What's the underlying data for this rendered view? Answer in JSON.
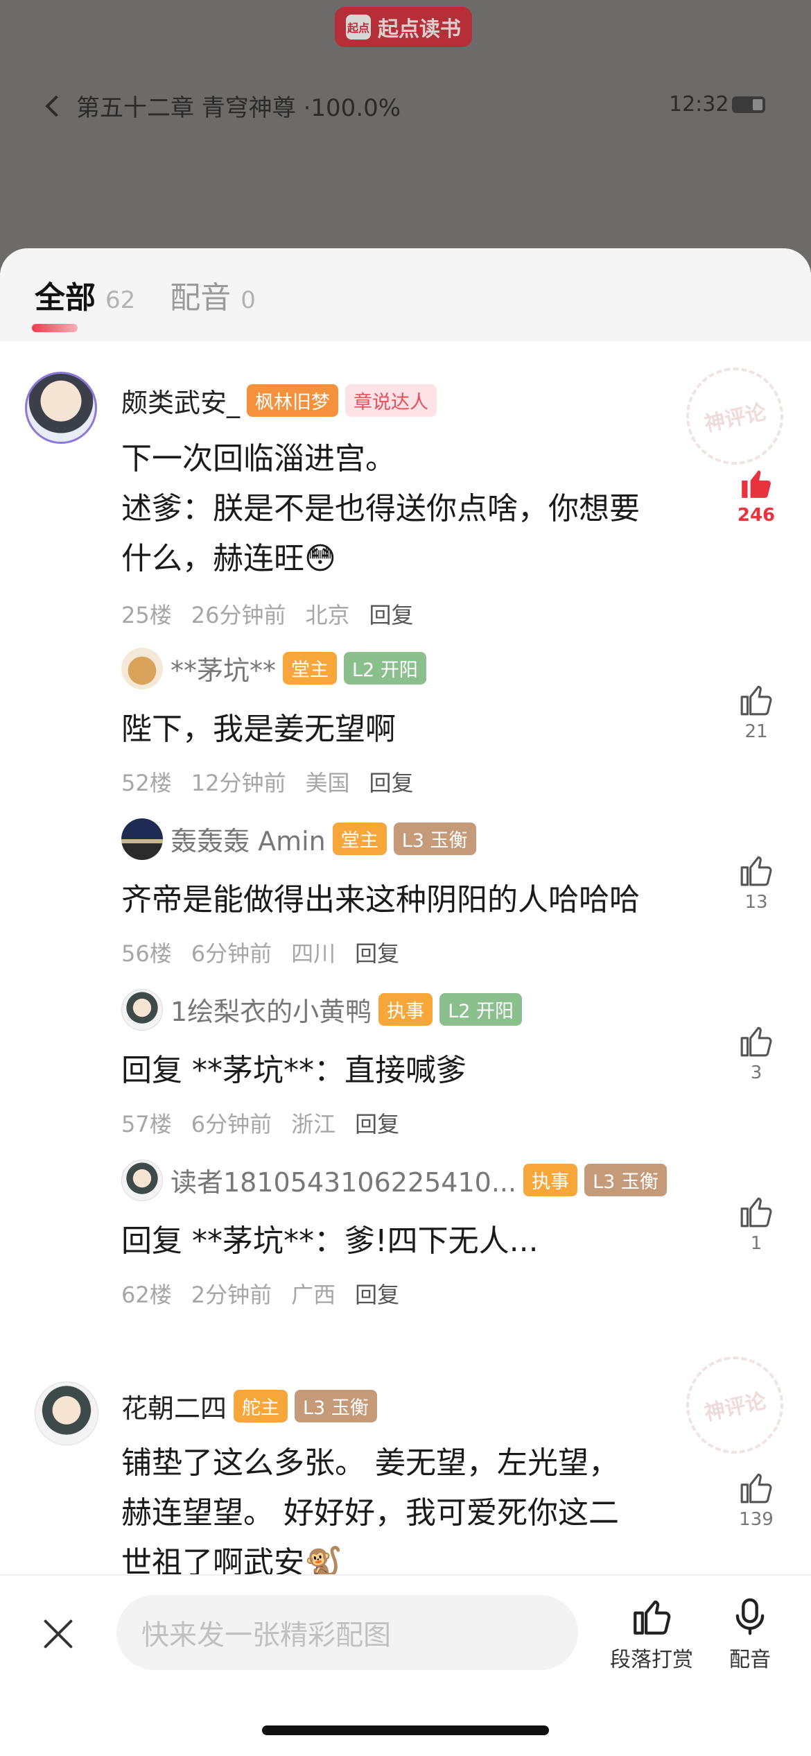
{
  "app": {
    "brand": "起点读书",
    "logo_text": "起点"
  },
  "reader": {
    "chapter": "第五十二章 青穹神尊 ·100.0%",
    "time": "12:32"
  },
  "tabs": [
    {
      "label": "全部",
      "count": "62"
    },
    {
      "label": "配音",
      "count": "0"
    }
  ],
  "stamp_text": "神评论",
  "comments": [
    {
      "name": "颇类武安_",
      "tags": [
        "枫林旧梦",
        "章说达人"
      ],
      "text_lines": [
        "下一次回临淄进宫。",
        "述爹：朕是不是也得送你点啥，你想要",
        "什么，赫连旺"
      ],
      "emoji": "😳",
      "meta": {
        "floor": "25楼",
        "time": "26分钟前",
        "location": "北京",
        "reply": "回复"
      },
      "likes": "246"
    },
    {
      "name": "**茅坑**",
      "tags": [
        "堂主",
        "L2 开阳"
      ],
      "text": "陛下，我是姜无望啊",
      "meta": {
        "floor": "52楼",
        "time": "12分钟前",
        "location": "美国",
        "reply": "回复"
      },
      "likes": "21"
    },
    {
      "name": "轰轰轰 Amin",
      "tags": [
        "堂主",
        "L3 玉衡"
      ],
      "text": "齐帝是能做得出来这种阴阳的人哈哈哈",
      "meta": {
        "floor": "56楼",
        "time": "6分钟前",
        "location": "四川",
        "reply": "回复"
      },
      "likes": "13"
    },
    {
      "name": "1绘梨衣的小黄鸭",
      "tags": [
        "执事",
        "L2 开阳"
      ],
      "text": "回复 **茅坑**：直接喊爹",
      "meta": {
        "floor": "57楼",
        "time": "6分钟前",
        "location": "浙江",
        "reply": "回复"
      },
      "likes": "3"
    },
    {
      "name": "读者1810543106225410...",
      "tags": [
        "执事",
        "L3 玉衡"
      ],
      "text": "回复 **茅坑**：爹!四下无人...",
      "meta": {
        "floor": "62楼",
        "time": "2分钟前",
        "location": "广西",
        "reply": "回复"
      },
      "likes": "1"
    },
    {
      "name": "花朝二四",
      "tags": [
        "舵主",
        "L3 玉衡"
      ],
      "text_lines": [
        "铺垫了这么多张。  姜无望，左光望，",
        "赫连望望。  好好好，我可爱死你这二",
        "世祖了啊武安"
      ],
      "emoji": "🐒",
      "likes": "139"
    }
  ],
  "bottom_bar": {
    "placeholder": "快来发一张精彩配图",
    "reward_label": "段落打赏",
    "dub_label": "配音"
  },
  "colors": {
    "accent": "#e8333f",
    "brand": "#c8202c"
  },
  "icons": [
    "back-chevron-icon",
    "battery-icon",
    "thumbs-up-icon",
    "close-icon",
    "reward-icon",
    "microphone-icon"
  ]
}
